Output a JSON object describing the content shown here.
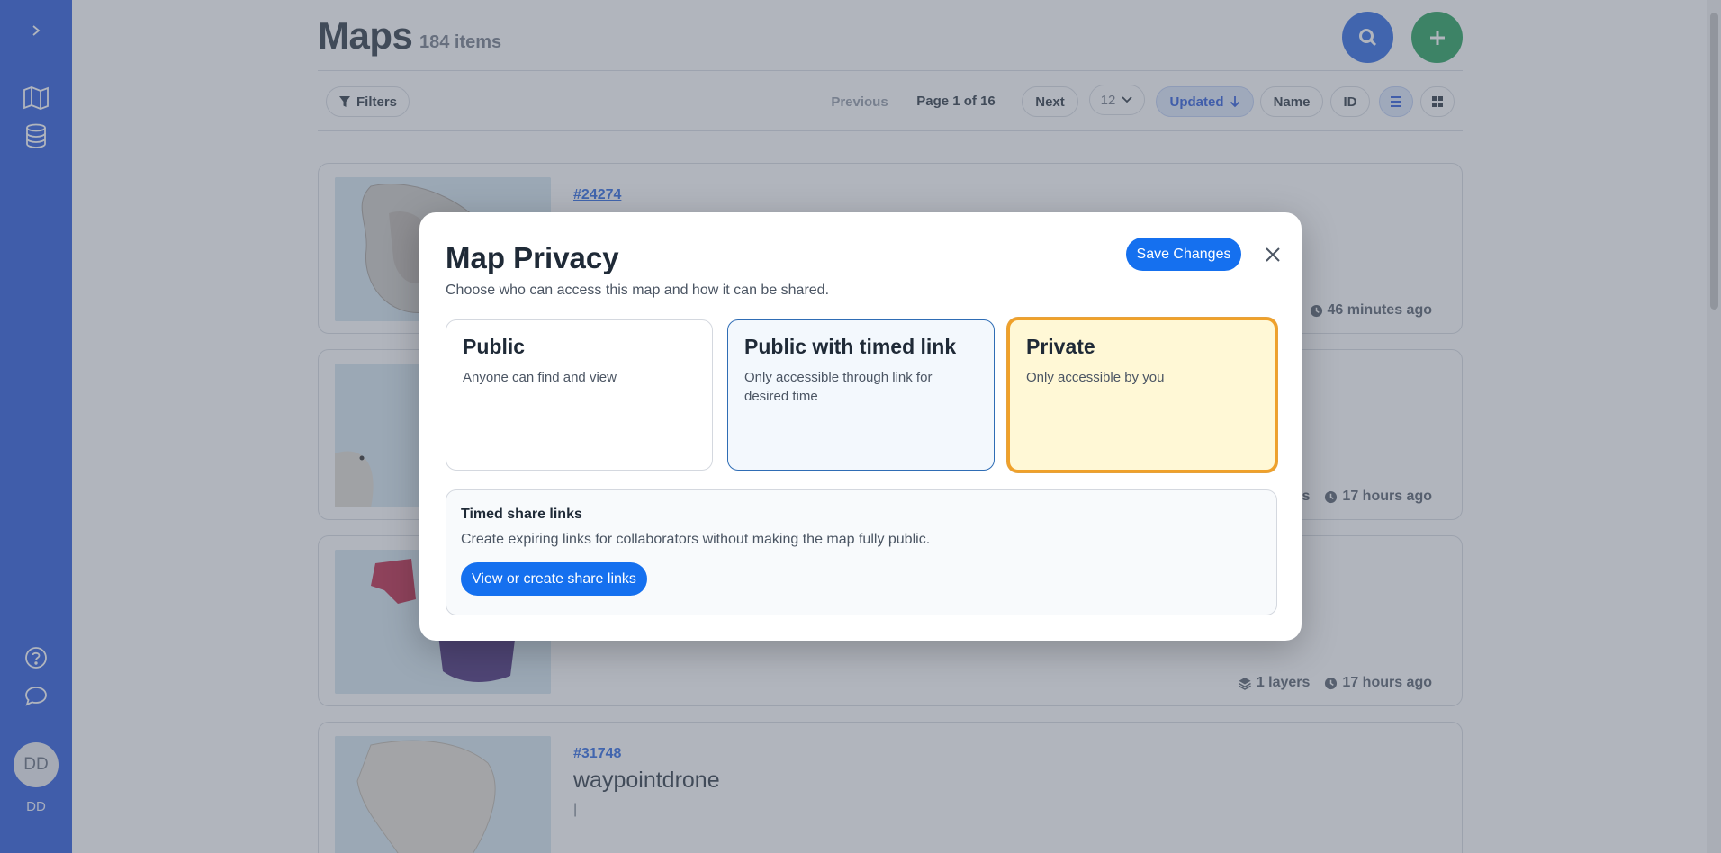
{
  "sidebar": {
    "avatar_initials": "DD",
    "avatar_label": "DD"
  },
  "header": {
    "title": "Maps",
    "count": "184 items"
  },
  "toolbar": {
    "filters_label": "Filters",
    "previous_label": "Previous",
    "page_label": "Page 1 of 16",
    "next_label": "Next",
    "per_page": "12",
    "sort_updated": "Updated",
    "sort_name": "Name",
    "sort_id": "ID"
  },
  "cards": [
    {
      "id": "#24274",
      "name": "",
      "desc": "",
      "layers": "",
      "updated": "46 minutes ago"
    },
    {
      "id": "",
      "name": "",
      "desc": "",
      "layers": "rs",
      "updated": "17 hours ago"
    },
    {
      "id": "",
      "name": "",
      "desc": "",
      "layers": "1 layers",
      "updated": "17 hours ago"
    },
    {
      "id": "#31748",
      "name": "waypointdrone",
      "desc": "|",
      "layers": "",
      "updated": ""
    }
  ],
  "modal": {
    "title": "Map Privacy",
    "subtitle": "Choose who can access this map and how it can be shared.",
    "save_label": "Save Changes",
    "options": [
      {
        "title": "Public",
        "desc": "Anyone can find and view"
      },
      {
        "title": "Public with timed link",
        "desc": "Only accessible through link for desired time"
      },
      {
        "title": "Private",
        "desc": "Only accessible by you"
      }
    ],
    "selected_option": "Private",
    "share": {
      "title": "Timed share links",
      "desc": "Create expiring links for collaborators without making the map fully public.",
      "button_label": "View or create share links"
    }
  },
  "colors": {
    "sidebar": "#1d4fd8",
    "primary_button": "#1570ef",
    "add_button": "#179a51",
    "selected_border": "#f0a12a",
    "selected_bg": "#fff8d6"
  }
}
